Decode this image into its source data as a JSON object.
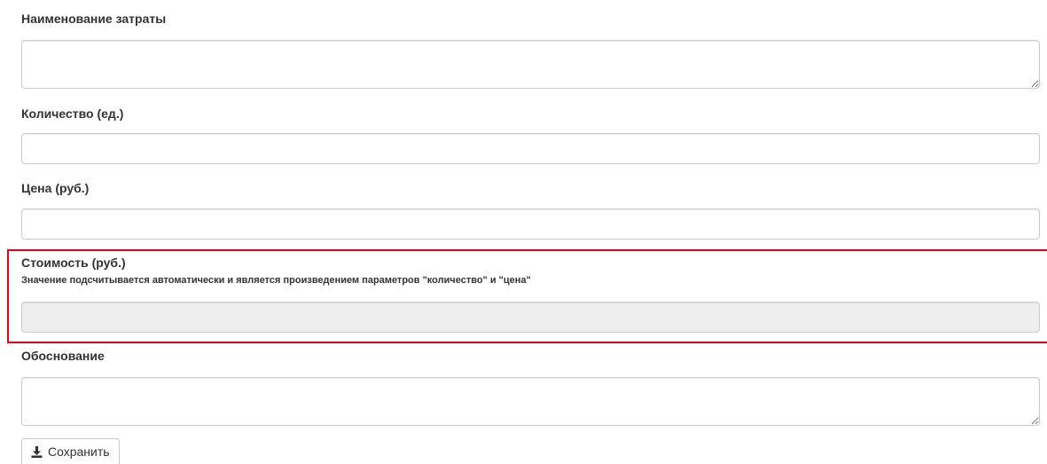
{
  "form": {
    "name": {
      "label": "Наименование затраты",
      "value": ""
    },
    "quantity": {
      "label": "Количество (ед.)",
      "value": ""
    },
    "price": {
      "label": "Цена (руб.)",
      "value": ""
    },
    "cost": {
      "label": "Стоимость (руб.)",
      "hint": "Значение подсчитывается автоматически и является произведением параметров \"количество\" и \"цена\"",
      "value": ""
    },
    "justification": {
      "label": "Обоснование",
      "value": ""
    },
    "save_label": "Сохранить",
    "save_icon": "download-icon"
  },
  "colors": {
    "highlight": "#e0001b",
    "readonly_bg": "#eeeeee",
    "border": "#cccccc",
    "text": "#333333"
  }
}
